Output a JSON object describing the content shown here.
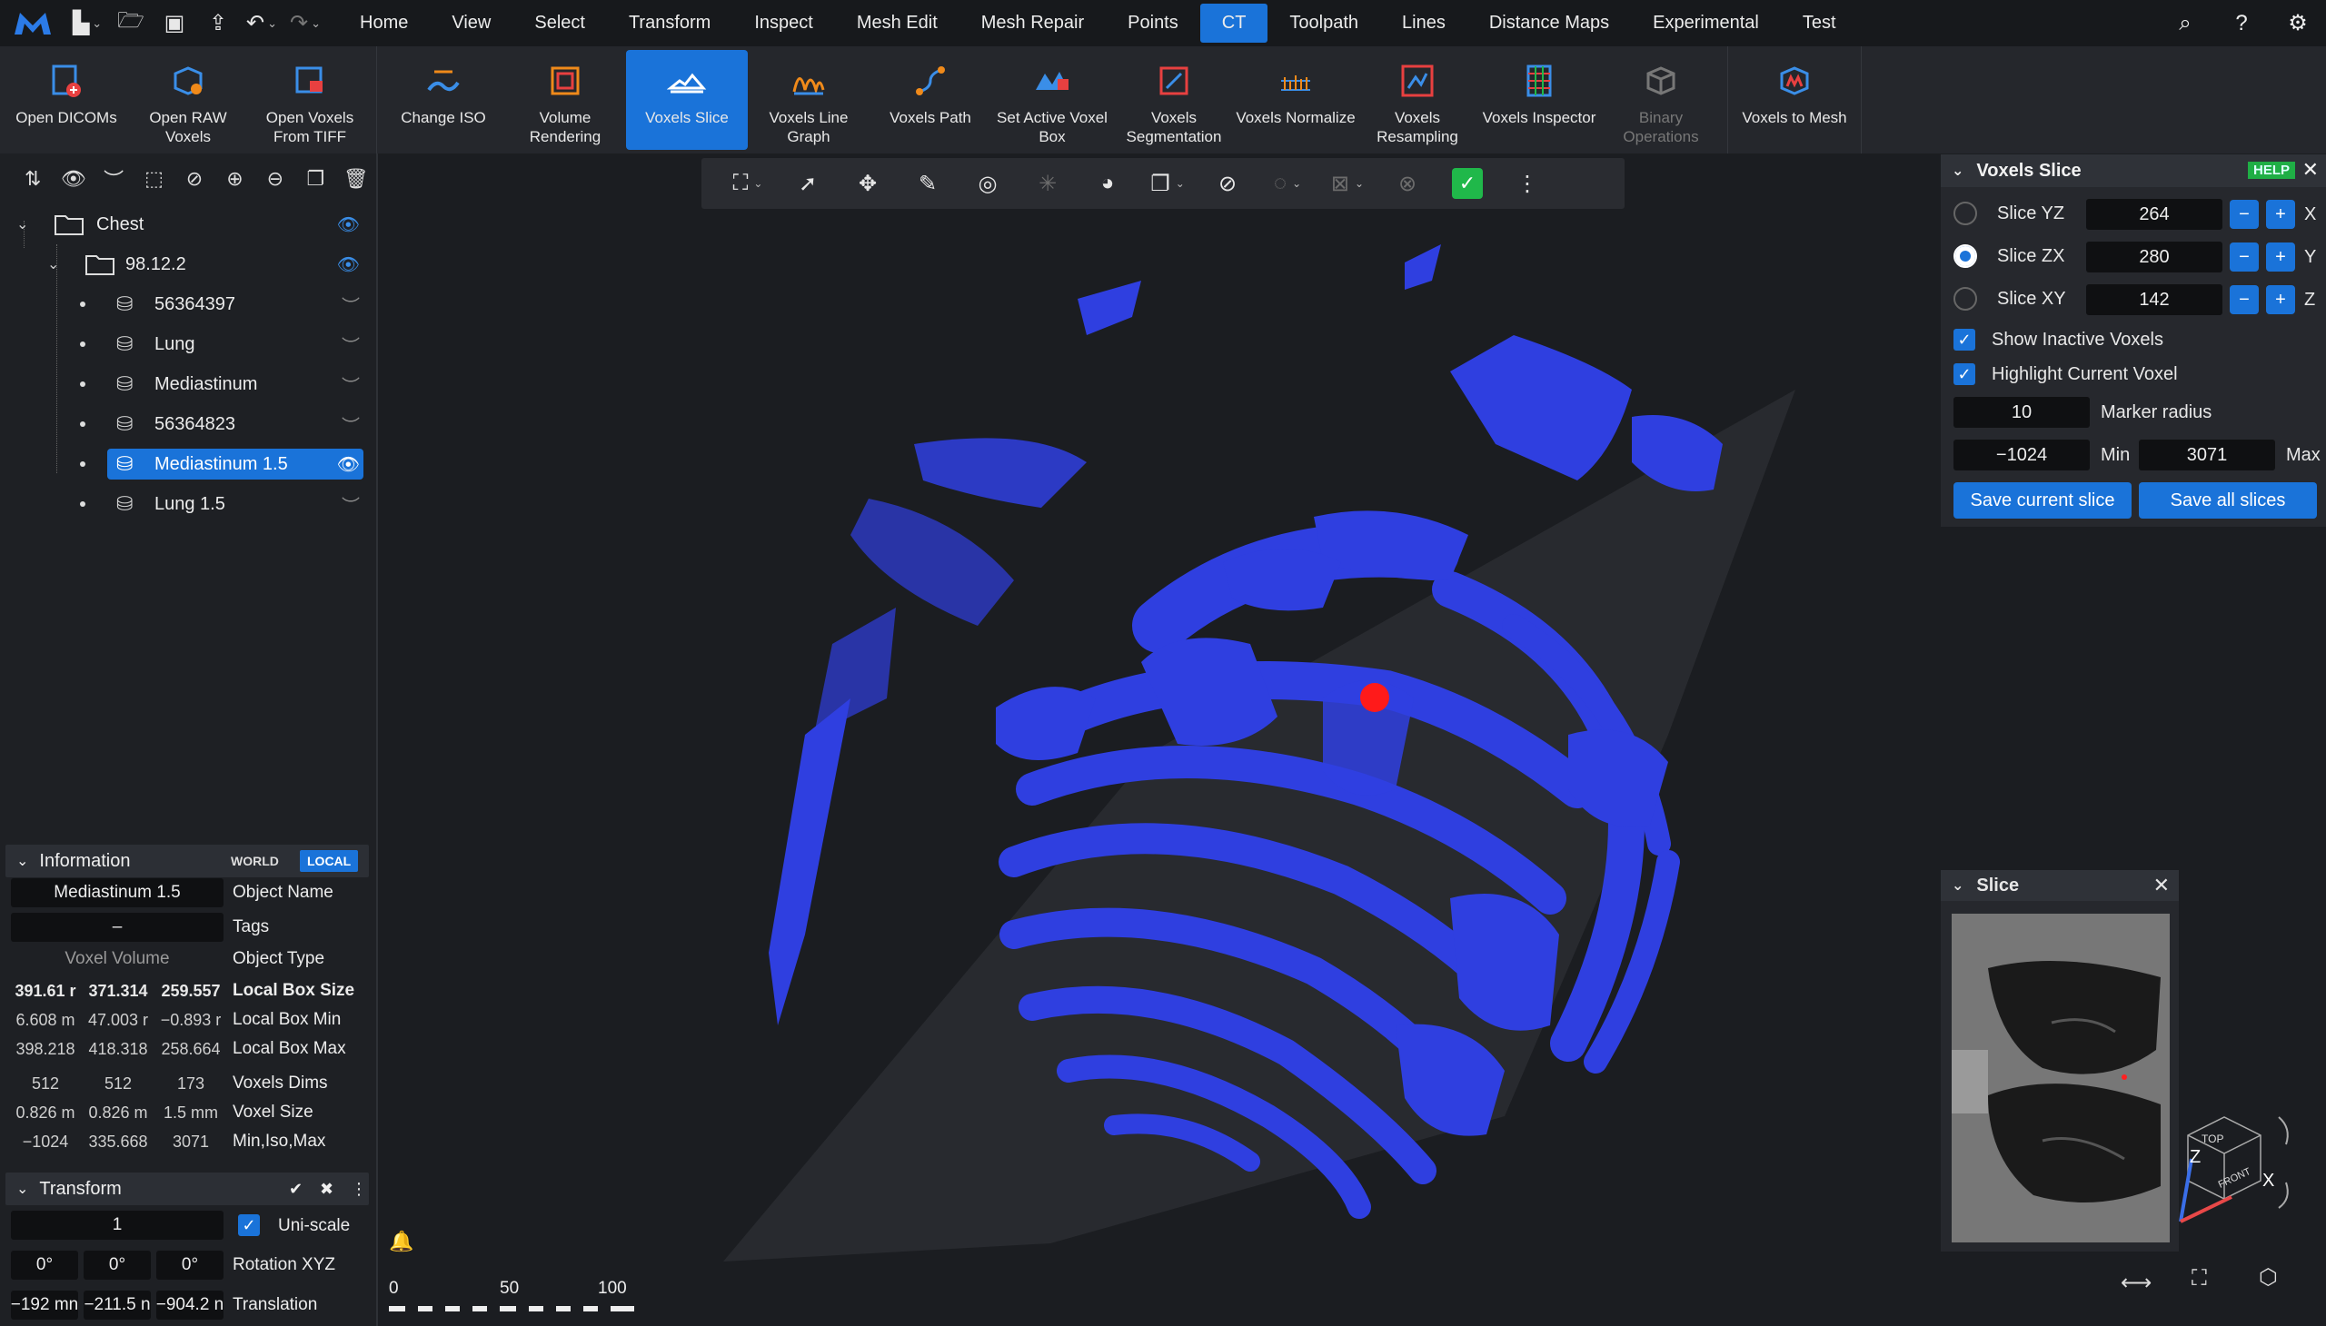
{
  "menu": {
    "tabs": [
      "Home",
      "View",
      "Select",
      "Transform",
      "Inspect",
      "Mesh Edit",
      "Mesh Repair",
      "Points",
      "CT",
      "Toolpath",
      "Lines",
      "Distance Maps",
      "Experimental",
      "Test"
    ],
    "active_tab": "CT"
  },
  "ribbon": {
    "buttons": [
      {
        "label": "Open DICOMs",
        "icon": "open-dicoms-icon"
      },
      {
        "label": "Open RAW Voxels",
        "icon": "open-raw-voxels-icon"
      },
      {
        "label": "Open Voxels From TIFF",
        "icon": "open-tiff-icon"
      },
      {
        "label": "Change ISO",
        "icon": "change-iso-icon"
      },
      {
        "label": "Volume Rendering",
        "icon": "volume-rendering-icon"
      },
      {
        "label": "Voxels Slice",
        "icon": "voxels-slice-icon"
      },
      {
        "label": "Voxels Line Graph",
        "icon": "line-graph-icon"
      },
      {
        "label": "Voxels Path",
        "icon": "voxels-path-icon"
      },
      {
        "label": "Set Active Voxel Box",
        "icon": "voxel-box-icon"
      },
      {
        "label": "Voxels Segmentation",
        "icon": "segmentation-icon"
      },
      {
        "label": "Voxels Normalize",
        "icon": "normalize-icon"
      },
      {
        "label": "Voxels Resampling",
        "icon": "resampling-icon"
      },
      {
        "label": "Voxels Inspector",
        "icon": "inspector-icon"
      },
      {
        "label": "Binary Operations",
        "icon": "binary-operations-icon"
      },
      {
        "label": "Voxels to Mesh",
        "icon": "voxels-to-mesh-icon"
      }
    ]
  },
  "tree": {
    "root": "Chest",
    "child": "98.12.2",
    "items": [
      "56364397",
      "Lung",
      "Mediastinum",
      "56364823",
      "Mediastinum 1.5",
      "Lung 1.5"
    ],
    "selected": "Mediastinum 1.5"
  },
  "info": {
    "title": "Information",
    "world_label": "WORLD",
    "local_label": "LOCAL",
    "object_name": "Mediastinum 1.5",
    "object_name_label": "Object Name",
    "tags": "–",
    "tags_label": "Tags",
    "object_type": "Voxel Volume",
    "object_type_label": "Object Type",
    "rows": [
      {
        "label": "Local Box Size",
        "values": [
          "391.61 r",
          "371.314",
          "259.557"
        ],
        "bold": true
      },
      {
        "label": "Local Box Min",
        "values": [
          "6.608 m",
          "47.003 r",
          "−0.893 r"
        ],
        "bold": false
      },
      {
        "label": "Local Box Max",
        "values": [
          "398.218",
          "418.318",
          "258.664"
        ],
        "bold": false
      },
      {
        "label": "Voxels Dims",
        "values": [
          "512",
          "512",
          "173"
        ],
        "bold": false
      },
      {
        "label": "Voxel Size",
        "values": [
          "0.826 m",
          "0.826 m",
          "1.5 mm"
        ],
        "bold": false
      },
      {
        "label": "Min,Iso,Max",
        "values": [
          "−1024",
          "335.668",
          "3071"
        ],
        "bold": false
      }
    ]
  },
  "transform": {
    "title": "Transform",
    "scale": "1",
    "uniscale_label": "Uni-scale",
    "rotation": [
      "0°",
      "0°",
      "0°"
    ],
    "rotation_label": "Rotation XYZ",
    "translation": [
      "−192 mn",
      "−211.5 n",
      "−904.2 n"
    ],
    "translation_label": "Translation"
  },
  "voxels_slice": {
    "title": "Voxels Slice",
    "help": "HELP",
    "slices": [
      {
        "label": "Slice YZ",
        "value": "264",
        "axis": "X",
        "selected": false
      },
      {
        "label": "Slice ZX",
        "value": "280",
        "axis": "Y",
        "selected": true
      },
      {
        "label": "Slice XY",
        "value": "142",
        "axis": "Z",
        "selected": false
      }
    ],
    "show_inactive": "Show Inactive Voxels",
    "highlight_current": "Highlight Current Voxel",
    "marker_radius": "10",
    "marker_radius_label": "Marker radius",
    "min": "−1024",
    "min_label": "Min",
    "max": "3071",
    "max_label": "Max",
    "save_current": "Save current slice",
    "save_all": "Save all slices"
  },
  "slice_panel": {
    "title": "Slice"
  },
  "scale_bar": {
    "labels": [
      "0",
      "50",
      "100"
    ]
  },
  "view_cube": {
    "top": "TOP",
    "front": "FRONT",
    "z": "Z",
    "x": "X"
  },
  "colors": {
    "accent": "#1a73d9",
    "mesh": "#2f3fe0",
    "marker": "#ff1a1a",
    "ok_green": "#20b84a"
  }
}
